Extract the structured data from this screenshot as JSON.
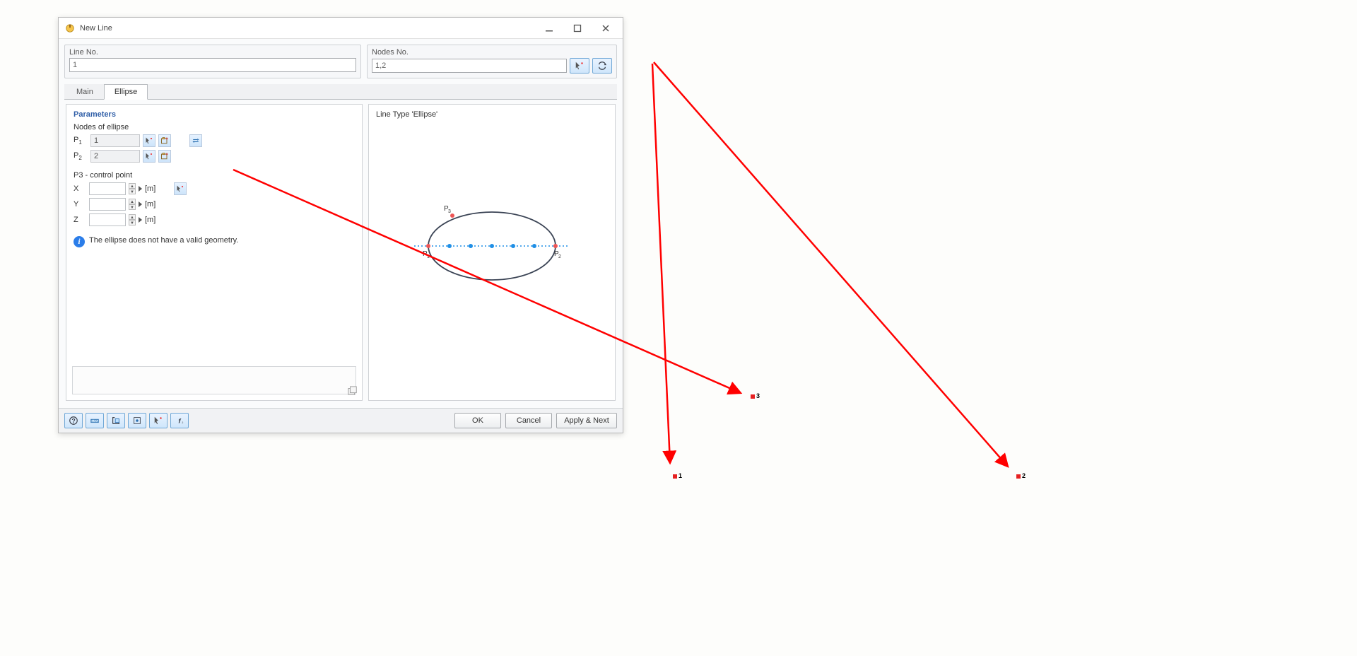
{
  "window": {
    "title": "New Line"
  },
  "top": {
    "line_no_label": "Line No.",
    "line_no_value": "1",
    "nodes_no_label": "Nodes No.",
    "nodes_no_value": "1,2"
  },
  "tabs": {
    "main": "Main",
    "ellipse": "Ellipse"
  },
  "params": {
    "group_label": "Parameters",
    "nodes_heading": "Nodes of ellipse",
    "p1_label": "P",
    "p1_sub": "1",
    "p1_value": "1",
    "p2_label": "P",
    "p2_sub": "2",
    "p2_value": "2",
    "p3_heading": "P3 - control point",
    "x_label": "X",
    "y_label": "Y",
    "z_label": "Z",
    "unit": "[m]",
    "info_text": "The ellipse does not have a valid geometry."
  },
  "preview": {
    "title": "Line Type 'Ellipse'",
    "p1": "P₁",
    "p2": "P₂",
    "p3": "P₃"
  },
  "footer": {
    "ok": "OK",
    "cancel": "Cancel",
    "apply_next": "Apply & Next"
  },
  "viewport": {
    "pt1": "1",
    "pt2": "2",
    "pt3": "3"
  }
}
